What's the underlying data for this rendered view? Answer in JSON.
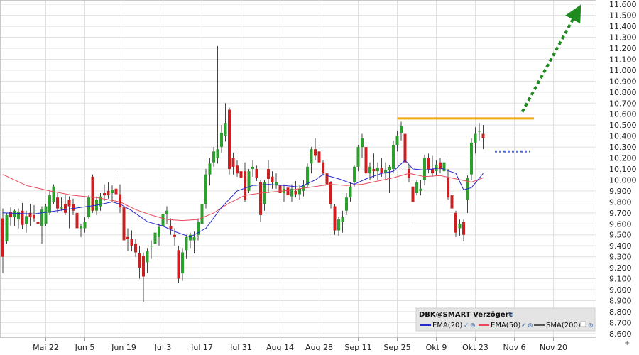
{
  "chart_data": {
    "type": "candlestick",
    "symbol": "DBK@SMART Verzögert",
    "y_ticks": [
      "11.600",
      "11.500",
      "11.400",
      "11.300",
      "11.200",
      "11.100",
      "11.000",
      "10.900",
      "10.800",
      "10.700",
      "10.600",
      "10.500",
      "10.400",
      "10.300",
      "10.200",
      "10.100",
      "10.000",
      "9.900",
      "9.800",
      "9.700",
      "9.600",
      "9.500",
      "9.400",
      "9.300",
      "9.200",
      "9.100",
      "9.000",
      "8.900",
      "8.800",
      "8.700",
      "8.600"
    ],
    "y_values": [
      11600,
      11500,
      11400,
      11300,
      11200,
      11100,
      11000,
      10900,
      10800,
      10700,
      10600,
      10500,
      10400,
      10300,
      10200,
      10100,
      10000,
      9900,
      9800,
      9700,
      9600,
      9500,
      9400,
      9300,
      9200,
      9100,
      9000,
      8900,
      8800,
      8700,
      8600
    ],
    "ylim": [
      8560,
      11640
    ],
    "x_ticks": [
      "Mai 22",
      "Jun 5",
      "Jun 19",
      "Jul 3",
      "Jul 17",
      "Jul 31",
      "Aug 14",
      "Aug 28",
      "Sep 11",
      "Sep 25",
      "Okt 9",
      "Okt 23",
      "Nov 6",
      "Nov 20"
    ],
    "x_tick_index": [
      11,
      21,
      31,
      41,
      51,
      61,
      71,
      81,
      91,
      101,
      111,
      121,
      131,
      141
    ],
    "grid": true,
    "legend": {
      "title": "DBK@SMART Verzögert",
      "items": [
        {
          "name": "EMA(20)",
          "color": "#2828cc"
        },
        {
          "name": "EMA(50)",
          "color": "#e64a5a"
        },
        {
          "name": "SMA(200)",
          "color": "#555555"
        }
      ],
      "placement": "bottom-right"
    },
    "colors": {
      "up": "#2ca02c",
      "down": "#cc2020",
      "ema20": "#2828cc",
      "ema50": "#e64a5a",
      "resistance": "#f0a818",
      "arrow": "#1f8a1f",
      "target": "#4a6cf0"
    },
    "annotations": [
      {
        "type": "resistance-line",
        "y": 10560,
        "from_index": 101,
        "to_index": 136
      },
      {
        "type": "support-dots",
        "y": 10260,
        "from_index": 126,
        "to_index": 135
      },
      {
        "type": "arrow",
        "from": [
          133,
          10620
        ],
        "to": [
          147,
          11530
        ]
      }
    ],
    "candles": [
      {
        "i": 0,
        "o": 9650,
        "h": 9740,
        "l": 9150,
        "c": 9300
      },
      {
        "i": 1,
        "o": 9440,
        "h": 9700,
        "l": 9420,
        "c": 9680
      },
      {
        "i": 2,
        "o": 9710,
        "h": 9750,
        "l": 9580,
        "c": 9660
      },
      {
        "i": 3,
        "o": 9660,
        "h": 9730,
        "l": 9580,
        "c": 9720
      },
      {
        "i": 4,
        "o": 9640,
        "h": 9740,
        "l": 9560,
        "c": 9710
      },
      {
        "i": 5,
        "o": 9720,
        "h": 9790,
        "l": 9550,
        "c": 9590
      },
      {
        "i": 6,
        "o": 9600,
        "h": 9720,
        "l": 9520,
        "c": 9670
      },
      {
        "i": 7,
        "o": 9700,
        "h": 9780,
        "l": 9580,
        "c": 9660
      },
      {
        "i": 8,
        "o": 9680,
        "h": 9770,
        "l": 9620,
        "c": 9650
      },
      {
        "i": 9,
        "o": 9620,
        "h": 9680,
        "l": 9580,
        "c": 9600
      },
      {
        "i": 10,
        "o": 9580,
        "h": 9760,
        "l": 9420,
        "c": 9730
      },
      {
        "i": 11,
        "o": 9600,
        "h": 9780,
        "l": 9580,
        "c": 9760
      },
      {
        "i": 12,
        "o": 9700,
        "h": 9900,
        "l": 9680,
        "c": 9860
      },
      {
        "i": 13,
        "o": 9800,
        "h": 9960,
        "l": 9780,
        "c": 9940
      },
      {
        "i": 14,
        "o": 9840,
        "h": 9880,
        "l": 9700,
        "c": 9740
      },
      {
        "i": 15,
        "o": 9740,
        "h": 9840,
        "l": 9720,
        "c": 9750
      },
      {
        "i": 16,
        "o": 9780,
        "h": 9860,
        "l": 9680,
        "c": 9700
      },
      {
        "i": 17,
        "o": 9820,
        "h": 9850,
        "l": 9560,
        "c": 9760
      },
      {
        "i": 18,
        "o": 9780,
        "h": 9830,
        "l": 9680,
        "c": 9720
      },
      {
        "i": 19,
        "o": 9700,
        "h": 9780,
        "l": 9520,
        "c": 9560
      },
      {
        "i": 20,
        "o": 9560,
        "h": 9600,
        "l": 9480,
        "c": 9580
      },
      {
        "i": 21,
        "o": 9560,
        "h": 9660,
        "l": 9520,
        "c": 9620
      },
      {
        "i": 22,
        "o": 9660,
        "h": 9860,
        "l": 9640,
        "c": 9840
      },
      {
        "i": 23,
        "o": 10030,
        "h": 10050,
        "l": 9700,
        "c": 9720
      },
      {
        "i": 24,
        "o": 9720,
        "h": 9850,
        "l": 9680,
        "c": 9820
      },
      {
        "i": 25,
        "o": 9760,
        "h": 9880,
        "l": 9720,
        "c": 9850
      },
      {
        "i": 26,
        "o": 9880,
        "h": 9960,
        "l": 9810,
        "c": 9860
      },
      {
        "i": 27,
        "o": 9900,
        "h": 9980,
        "l": 9830,
        "c": 9860
      },
      {
        "i": 28,
        "o": 9880,
        "h": 9950,
        "l": 9800,
        "c": 9910
      },
      {
        "i": 29,
        "o": 9920,
        "h": 10060,
        "l": 9850,
        "c": 9870
      },
      {
        "i": 30,
        "o": 9870,
        "h": 9960,
        "l": 9700,
        "c": 9750
      },
      {
        "i": 31,
        "o": 9750,
        "h": 9840,
        "l": 9400,
        "c": 9450
      },
      {
        "i": 32,
        "o": 9480,
        "h": 9560,
        "l": 9350,
        "c": 9460
      },
      {
        "i": 33,
        "o": 9460,
        "h": 9540,
        "l": 9350,
        "c": 9400
      },
      {
        "i": 34,
        "o": 9420,
        "h": 9460,
        "l": 9300,
        "c": 9340
      },
      {
        "i": 35,
        "o": 9330,
        "h": 9400,
        "l": 9100,
        "c": 9200
      },
      {
        "i": 36,
        "o": 9310,
        "h": 9340,
        "l": 8890,
        "c": 9120
      },
      {
        "i": 37,
        "o": 9250,
        "h": 9380,
        "l": 9150,
        "c": 9350
      },
      {
        "i": 38,
        "o": 9400,
        "h": 9450,
        "l": 9280,
        "c": 9400
      },
      {
        "i": 39,
        "o": 9420,
        "h": 9560,
        "l": 9300,
        "c": 9520
      },
      {
        "i": 40,
        "o": 9480,
        "h": 9600,
        "l": 9400,
        "c": 9570
      },
      {
        "i": 41,
        "o": 9580,
        "h": 9720,
        "l": 9540,
        "c": 9690
      },
      {
        "i": 42,
        "o": 9690,
        "h": 9760,
        "l": 9600,
        "c": 9720
      },
      {
        "i": 43,
        "o": 9580,
        "h": 9650,
        "l": 9500,
        "c": 9550
      },
      {
        "i": 44,
        "o": 9500,
        "h": 9560,
        "l": 9400,
        "c": 9480
      },
      {
        "i": 45,
        "o": 9360,
        "h": 9400,
        "l": 9060,
        "c": 9100
      },
      {
        "i": 46,
        "o": 9150,
        "h": 9380,
        "l": 9080,
        "c": 9340
      },
      {
        "i": 47,
        "o": 9360,
        "h": 9500,
        "l": 9280,
        "c": 9480
      },
      {
        "i": 48,
        "o": 9450,
        "h": 9520,
        "l": 9380,
        "c": 9500
      },
      {
        "i": 49,
        "o": 9450,
        "h": 9530,
        "l": 9330,
        "c": 9480
      },
      {
        "i": 50,
        "o": 9500,
        "h": 9650,
        "l": 9450,
        "c": 9620
      },
      {
        "i": 51,
        "o": 9600,
        "h": 9800,
        "l": 9560,
        "c": 9780
      },
      {
        "i": 52,
        "o": 9780,
        "h": 10100,
        "l": 9740,
        "c": 10050
      },
      {
        "i": 53,
        "o": 10050,
        "h": 10200,
        "l": 9950,
        "c": 10150
      },
      {
        "i": 54,
        "o": 10160,
        "h": 10300,
        "l": 10120,
        "c": 10260
      },
      {
        "i": 55,
        "o": 10200,
        "h": 11220,
        "l": 10150,
        "c": 10280
      },
      {
        "i": 56,
        "o": 10300,
        "h": 10500,
        "l": 10250,
        "c": 10430
      },
      {
        "i": 57,
        "o": 10400,
        "h": 10700,
        "l": 10350,
        "c": 10520
      },
      {
        "i": 58,
        "o": 10640,
        "h": 10660,
        "l": 10050,
        "c": 10100
      },
      {
        "i": 59,
        "o": 10200,
        "h": 10250,
        "l": 10050,
        "c": 10120
      },
      {
        "i": 60,
        "o": 10130,
        "h": 10180,
        "l": 10030,
        "c": 10060
      },
      {
        "i": 61,
        "o": 10080,
        "h": 10160,
        "l": 9980,
        "c": 10020
      },
      {
        "i": 62,
        "o": 10080,
        "h": 10160,
        "l": 9800,
        "c": 9820
      },
      {
        "i": 63,
        "o": 9900,
        "h": 10100,
        "l": 9880,
        "c": 10080
      },
      {
        "i": 64,
        "o": 10100,
        "h": 10180,
        "l": 10030,
        "c": 10120
      },
      {
        "i": 65,
        "o": 10100,
        "h": 10130,
        "l": 9990,
        "c": 10020
      },
      {
        "i": 66,
        "o": 9980,
        "h": 10000,
        "l": 9620,
        "c": 9680
      },
      {
        "i": 67,
        "o": 9780,
        "h": 10000,
        "l": 9720,
        "c": 9980
      },
      {
        "i": 68,
        "o": 10100,
        "h": 10180,
        "l": 9880,
        "c": 10010
      },
      {
        "i": 69,
        "o": 10030,
        "h": 10080,
        "l": 9920,
        "c": 9980
      },
      {
        "i": 70,
        "o": 9950,
        "h": 10060,
        "l": 9920,
        "c": 9980
      },
      {
        "i": 71,
        "o": 9950,
        "h": 10000,
        "l": 9820,
        "c": 9880
      },
      {
        "i": 72,
        "o": 9880,
        "h": 9960,
        "l": 9800,
        "c": 9920
      },
      {
        "i": 73,
        "o": 9930,
        "h": 9960,
        "l": 9840,
        "c": 9860
      },
      {
        "i": 74,
        "o": 9850,
        "h": 9960,
        "l": 9800,
        "c": 9920
      },
      {
        "i": 75,
        "o": 9900,
        "h": 9990,
        "l": 9840,
        "c": 9870
      },
      {
        "i": 76,
        "o": 9870,
        "h": 9950,
        "l": 9820,
        "c": 9920
      },
      {
        "i": 77,
        "o": 9900,
        "h": 10000,
        "l": 9850,
        "c": 9950
      },
      {
        "i": 78,
        "o": 9950,
        "h": 10150,
        "l": 9930,
        "c": 10120
      },
      {
        "i": 79,
        "o": 10150,
        "h": 10300,
        "l": 10060,
        "c": 10280
      },
      {
        "i": 80,
        "o": 10280,
        "h": 10380,
        "l": 10180,
        "c": 10220
      },
      {
        "i": 81,
        "o": 10260,
        "h": 10300,
        "l": 10140,
        "c": 10160
      },
      {
        "i": 82,
        "o": 10160,
        "h": 10180,
        "l": 10040,
        "c": 10060
      },
      {
        "i": 83,
        "o": 10060,
        "h": 10120,
        "l": 9920,
        "c": 9960
      },
      {
        "i": 84,
        "o": 9980,
        "h": 9990,
        "l": 9740,
        "c": 9780
      },
      {
        "i": 85,
        "o": 9760,
        "h": 9780,
        "l": 9500,
        "c": 9540
      },
      {
        "i": 86,
        "o": 9540,
        "h": 9660,
        "l": 9490,
        "c": 9640
      },
      {
        "i": 87,
        "o": 9620,
        "h": 9720,
        "l": 9520,
        "c": 9660
      },
      {
        "i": 88,
        "o": 9720,
        "h": 9880,
        "l": 9680,
        "c": 9840
      },
      {
        "i": 89,
        "o": 9840,
        "h": 9980,
        "l": 9800,
        "c": 9940
      },
      {
        "i": 90,
        "o": 9980,
        "h": 10130,
        "l": 9940,
        "c": 10120
      },
      {
        "i": 91,
        "o": 10120,
        "h": 10320,
        "l": 10080,
        "c": 10300
      },
      {
        "i": 92,
        "o": 10300,
        "h": 10420,
        "l": 10200,
        "c": 10380
      },
      {
        "i": 93,
        "o": 10300,
        "h": 10340,
        "l": 10000,
        "c": 10060
      },
      {
        "i": 94,
        "o": 10060,
        "h": 10160,
        "l": 10000,
        "c": 10120
      },
      {
        "i": 95,
        "o": 10100,
        "h": 10240,
        "l": 10020,
        "c": 10080
      },
      {
        "i": 96,
        "o": 10080,
        "h": 10160,
        "l": 10000,
        "c": 10110
      },
      {
        "i": 97,
        "o": 10110,
        "h": 10200,
        "l": 10030,
        "c": 10060
      },
      {
        "i": 98,
        "o": 10060,
        "h": 10160,
        "l": 10010,
        "c": 10090
      },
      {
        "i": 99,
        "o": 10090,
        "h": 10140,
        "l": 9880,
        "c": 10120
      },
      {
        "i": 100,
        "o": 10100,
        "h": 10360,
        "l": 10060,
        "c": 10320
      },
      {
        "i": 101,
        "o": 10320,
        "h": 10450,
        "l": 10260,
        "c": 10400
      },
      {
        "i": 102,
        "o": 10430,
        "h": 10530,
        "l": 10360,
        "c": 10490
      },
      {
        "i": 103,
        "o": 10420,
        "h": 10520,
        "l": 10140,
        "c": 10160
      },
      {
        "i": 104,
        "o": 10100,
        "h": 10140,
        "l": 9980,
        "c": 10020
      },
      {
        "i": 105,
        "o": 9940,
        "h": 10000,
        "l": 9610,
        "c": 9800
      },
      {
        "i": 106,
        "o": 9880,
        "h": 10000,
        "l": 9860,
        "c": 9980
      },
      {
        "i": 107,
        "o": 9900,
        "h": 10000,
        "l": 9860,
        "c": 9920
      },
      {
        "i": 108,
        "o": 10000,
        "h": 10230,
        "l": 9950,
        "c": 10200
      },
      {
        "i": 109,
        "o": 10200,
        "h": 10240,
        "l": 10060,
        "c": 10100
      },
      {
        "i": 110,
        "o": 10100,
        "h": 10220,
        "l": 10030,
        "c": 10060
      },
      {
        "i": 111,
        "o": 10080,
        "h": 10180,
        "l": 10040,
        "c": 10140
      },
      {
        "i": 112,
        "o": 10160,
        "h": 10200,
        "l": 10060,
        "c": 10100
      },
      {
        "i": 113,
        "o": 10080,
        "h": 10200,
        "l": 10000,
        "c": 10160
      },
      {
        "i": 114,
        "o": 10020,
        "h": 10100,
        "l": 9820,
        "c": 9840
      },
      {
        "i": 115,
        "o": 9860,
        "h": 9900,
        "l": 9700,
        "c": 9740
      },
      {
        "i": 116,
        "o": 9700,
        "h": 9720,
        "l": 9480,
        "c": 9520
      },
      {
        "i": 117,
        "o": 9560,
        "h": 9640,
        "l": 9490,
        "c": 9600
      },
      {
        "i": 118,
        "o": 9620,
        "h": 9640,
        "l": 9440,
        "c": 9500
      },
      {
        "i": 119,
        "o": 9820,
        "h": 10040,
        "l": 9700,
        "c": 10020
      },
      {
        "i": 120,
        "o": 10050,
        "h": 10380,
        "l": 10000,
        "c": 10340
      },
      {
        "i": 121,
        "o": 10340,
        "h": 10480,
        "l": 10240,
        "c": 10420
      },
      {
        "i": 122,
        "o": 10440,
        "h": 10520,
        "l": 10360,
        "c": 10450
      },
      {
        "i": 123,
        "o": 10420,
        "h": 10500,
        "l": 10280,
        "c": 10380
      }
    ],
    "ema20": [
      [
        0,
        9700
      ],
      [
        8,
        9690
      ],
      [
        12,
        9710
      ],
      [
        18,
        9740
      ],
      [
        24,
        9770
      ],
      [
        28,
        9800
      ],
      [
        30,
        9780
      ],
      [
        33,
        9720
      ],
      [
        37,
        9620
      ],
      [
        41,
        9580
      ],
      [
        44,
        9530
      ],
      [
        48,
        9480
      ],
      [
        52,
        9560
      ],
      [
        56,
        9750
      ],
      [
        60,
        9900
      ],
      [
        64,
        9950
      ],
      [
        68,
        9960
      ],
      [
        72,
        9950
      ],
      [
        76,
        9935
      ],
      [
        80,
        10000
      ],
      [
        82,
        10050
      ],
      [
        86,
        10010
      ],
      [
        90,
        9960
      ],
      [
        93,
        10010
      ],
      [
        97,
        10060
      ],
      [
        100,
        10080
      ],
      [
        103,
        10180
      ],
      [
        105,
        10100
      ],
      [
        108,
        10090
      ],
      [
        112,
        10110
      ],
      [
        116,
        10060
      ],
      [
        118,
        9910
      ],
      [
        120,
        9930
      ],
      [
        123,
        10060
      ]
    ],
    "ema50": [
      [
        0,
        10050
      ],
      [
        6,
        9950
      ],
      [
        12,
        9900
      ],
      [
        18,
        9860
      ],
      [
        24,
        9840
      ],
      [
        30,
        9800
      ],
      [
        34,
        9730
      ],
      [
        38,
        9680
      ],
      [
        42,
        9640
      ],
      [
        46,
        9630
      ],
      [
        50,
        9640
      ],
      [
        54,
        9700
      ],
      [
        58,
        9790
      ],
      [
        62,
        9860
      ],
      [
        66,
        9880
      ],
      [
        72,
        9900
      ],
      [
        78,
        9930
      ],
      [
        84,
        9960
      ],
      [
        88,
        9950
      ],
      [
        92,
        9960
      ],
      [
        96,
        9990
      ],
      [
        100,
        10020
      ],
      [
        104,
        10060
      ],
      [
        108,
        10030
      ],
      [
        112,
        10040
      ],
      [
        116,
        10010
      ],
      [
        120,
        9980
      ],
      [
        123,
        10020
      ]
    ]
  }
}
